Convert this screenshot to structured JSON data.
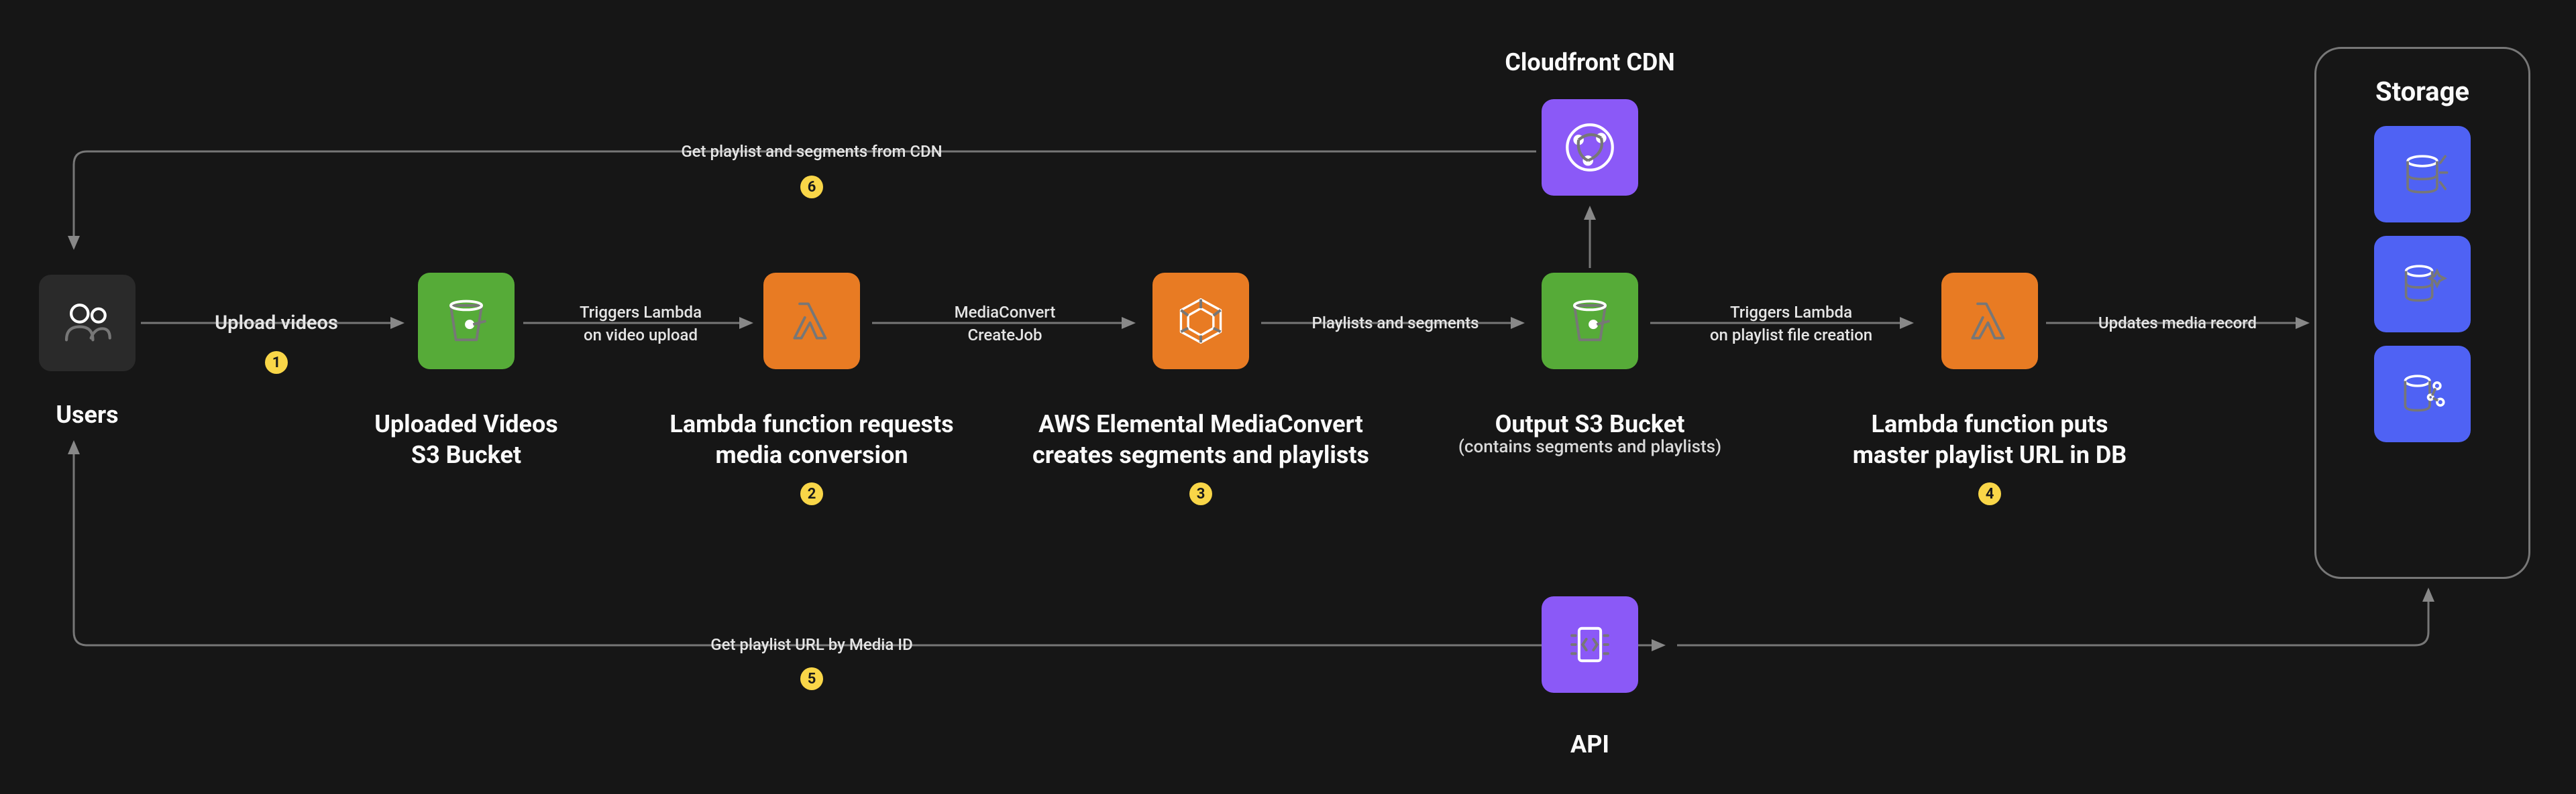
{
  "nodes": {
    "users": {
      "label": "Users"
    },
    "uploaded": {
      "label1": "Uploaded Videos",
      "label2": "S3 Bucket"
    },
    "lambda1": {
      "label1": "Lambda function requests",
      "label2": "media conversion",
      "step": "2"
    },
    "mediaconv": {
      "label1": "AWS Elemental MediaConvert",
      "label2": "creates segments and playlists",
      "step": "3"
    },
    "output": {
      "label1": "Output S3 Bucket",
      "label2": "(contains segments and playlists)"
    },
    "lambda2": {
      "label1": "Lambda function puts",
      "label2": "master playlist URL in DB",
      "step": "4"
    },
    "cloudfront": {
      "label": "Cloudfront CDN"
    },
    "api": {
      "label": "API"
    },
    "storage_label": "Storage"
  },
  "edges": {
    "upload": {
      "label": "Upload videos",
      "step": "1"
    },
    "trigger1": {
      "label1": "Triggers Lambda",
      "label2": "on video upload"
    },
    "createjob": {
      "label1": "MediaConvert",
      "label2": "CreateJob"
    },
    "playlists": {
      "label": "Playlists and segments"
    },
    "trigger2": {
      "label1": "Triggers Lambda",
      "label2": "on playlist file creation"
    },
    "update": {
      "label": "Updates media record"
    },
    "cdn": {
      "label": "Get playlist and segments from CDN",
      "step": "6"
    },
    "mediaid": {
      "label": "Get playlist URL by Media ID",
      "step": "5"
    }
  }
}
